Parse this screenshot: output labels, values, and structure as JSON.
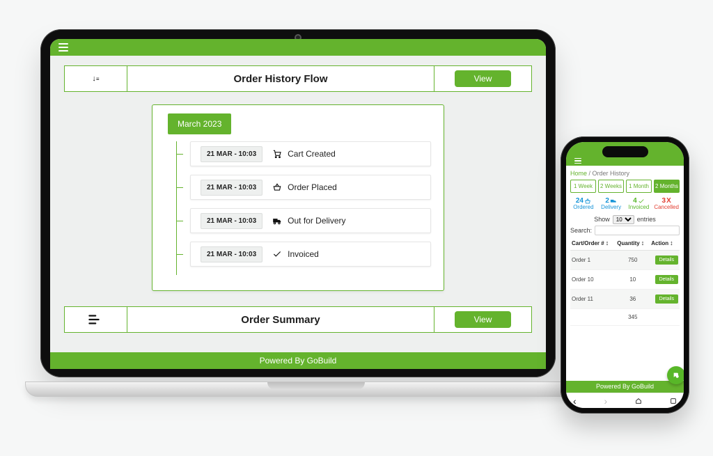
{
  "branding": {
    "footer": "Powered By GoBuild"
  },
  "laptop": {
    "flow": {
      "title": "Order History Flow",
      "view_label": "View",
      "sort_label": "Sort",
      "month": "March 2023",
      "events": [
        {
          "ts": "21 MAR - 10:03",
          "label": "Cart Created",
          "icon": "cart-icon"
        },
        {
          "ts": "21 MAR - 10:03",
          "label": "Order Placed",
          "icon": "basket-icon"
        },
        {
          "ts": "21 MAR - 10:03",
          "label": "Out for Delivery",
          "icon": "truck-icon"
        },
        {
          "ts": "21 MAR - 10:03",
          "label": "Invoiced",
          "icon": "check-icon"
        }
      ]
    },
    "summary": {
      "title": "Order Summary",
      "view_label": "View"
    }
  },
  "phone": {
    "breadcrumb": {
      "home": "Home",
      "current": "Order History"
    },
    "ranges": [
      "1 Week",
      "2 Weeks",
      "1 Month",
      "2 Months"
    ],
    "active_range_index": 3,
    "kpis": [
      {
        "value": "24",
        "label": "Ordered",
        "icon": "basket-icon",
        "color": "blue"
      },
      {
        "value": "2",
        "label": "Delivery",
        "icon": "truck-icon",
        "color": "blue"
      },
      {
        "value": "4",
        "label": "Invoiced",
        "icon": "check-icon",
        "color": "green"
      },
      {
        "value": "3",
        "label": "Cancelled",
        "icon": "x-icon",
        "color": "red"
      }
    ],
    "table": {
      "show_label": "Show",
      "entries_label": "entries",
      "page_size": "10",
      "search_label": "Search:",
      "columns": [
        "Cart/Order #",
        "Quantity",
        "Action"
      ],
      "rows": [
        {
          "order": "Order 1",
          "qty": "750",
          "action": "Details"
        },
        {
          "order": "Order 10",
          "qty": "10",
          "action": "Details"
        },
        {
          "order": "Order 11",
          "qty": "36",
          "action": "Details"
        },
        {
          "order": "",
          "qty": "345",
          "action": ""
        }
      ]
    }
  }
}
